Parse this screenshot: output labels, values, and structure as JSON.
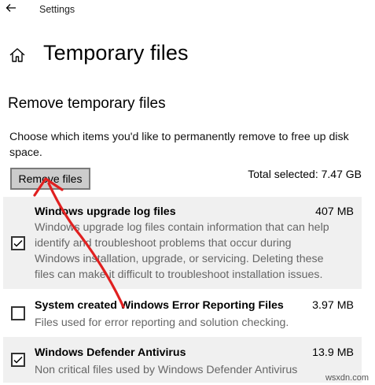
{
  "titlebar": {
    "back_icon": "back-arrow-icon",
    "title": "Settings"
  },
  "header": {
    "home_icon": "home-icon",
    "title": "Temporary files"
  },
  "section": {
    "title": "Remove temporary files",
    "description": "Choose which items you'd like to permanently remove to free up disk space.",
    "remove_button": "Remove files",
    "total_selected": "Total selected: 7.47 GB"
  },
  "items": [
    {
      "name": "Windows upgrade log files",
      "size": "407 MB",
      "checked": true,
      "description": "Windows upgrade log files contain information that can help identify and troubleshoot problems that occur during Windows installation, upgrade, or servicing.  Deleting these files can make it difficult to troubleshoot installation issues."
    },
    {
      "name": "System created Windows Error Reporting Files",
      "size": "3.97 MB",
      "checked": false,
      "description": "Files used for error reporting and solution checking."
    },
    {
      "name": "Windows Defender Antivirus",
      "size": "13.9 MB",
      "checked": true,
      "description": "Non critical files used by Windows Defender Antivirus"
    }
  ],
  "annotation": {
    "color": "#e02020"
  },
  "watermark": "wsxdn.com"
}
